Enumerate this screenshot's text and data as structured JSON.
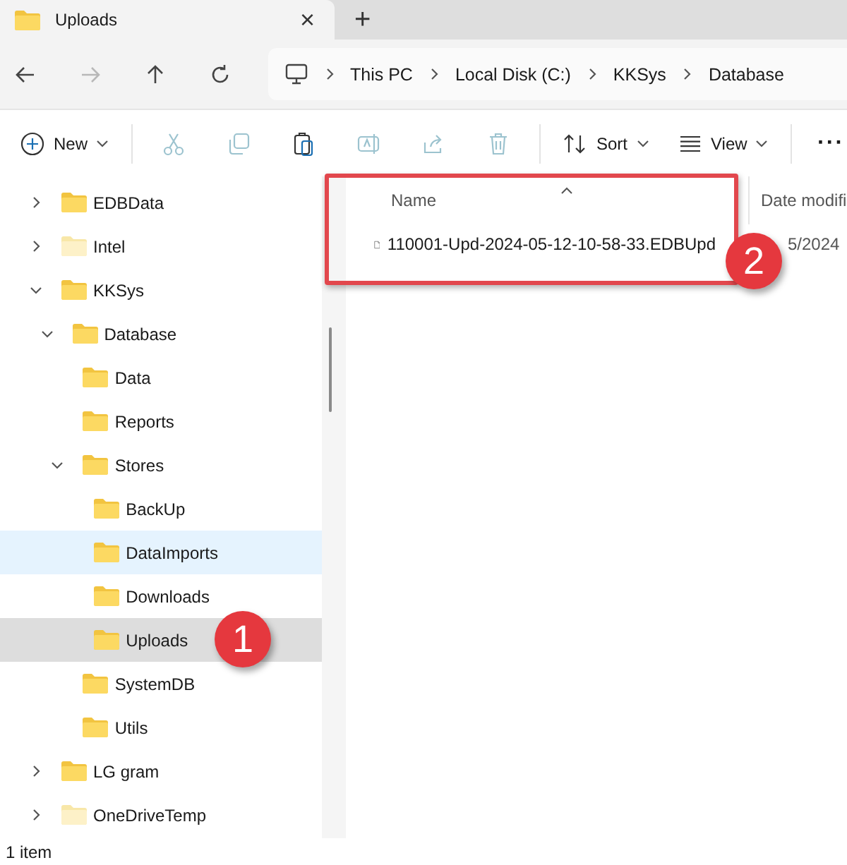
{
  "tab": {
    "title": "Uploads",
    "close": "×",
    "new_tab": "+"
  },
  "nav": {
    "back_disabled": false,
    "forward_disabled": true
  },
  "breadcrumbs": [
    "This PC",
    "Local Disk (C:)",
    "KKSys",
    "Database"
  ],
  "toolbar": {
    "new_label": "New",
    "sort_label": "Sort",
    "view_label": "View",
    "more": "···"
  },
  "tree": [
    {
      "label": "EDBData",
      "expanded": false,
      "hidden": false,
      "selected": false,
      "hovered": false
    },
    {
      "label": "Intel",
      "expanded": false,
      "hidden": true,
      "selected": false,
      "hovered": false
    },
    {
      "label": "KKSys",
      "expanded": true,
      "hidden": false,
      "selected": false,
      "hovered": false,
      "children": [
        {
          "label": "Database",
          "expanded": true,
          "hidden": false,
          "selected": false,
          "hovered": false,
          "children": [
            {
              "label": "Data",
              "hidden": false,
              "selected": false,
              "hovered": false
            },
            {
              "label": "Reports",
              "hidden": false,
              "selected": false,
              "hovered": false
            },
            {
              "label": "Stores",
              "expanded": true,
              "hidden": false,
              "selected": false,
              "hovered": false,
              "children": [
                {
                  "label": "BackUp",
                  "hidden": false,
                  "selected": false,
                  "hovered": false
                },
                {
                  "label": "DataImports",
                  "hidden": false,
                  "selected": false,
                  "hovered": true
                },
                {
                  "label": "Downloads",
                  "hidden": false,
                  "selected": false,
                  "hovered": false
                },
                {
                  "label": "Uploads",
                  "hidden": false,
                  "selected": true,
                  "hovered": false
                }
              ]
            },
            {
              "label": "SystemDB",
              "hidden": false,
              "selected": false,
              "hovered": false
            },
            {
              "label": "Utils",
              "hidden": false,
              "selected": false,
              "hovered": false
            }
          ]
        }
      ]
    },
    {
      "label": "LG gram",
      "expanded": false,
      "hidden": false,
      "selected": false,
      "hovered": false
    },
    {
      "label": "OneDriveTemp",
      "expanded": false,
      "hidden": true,
      "selected": false,
      "hovered": false
    }
  ],
  "columns": [
    {
      "label": "Name",
      "sorted": true
    },
    {
      "label": "Date modifi"
    }
  ],
  "files": [
    {
      "name": "110001-Upd-2024-05-12-10-58-33.EDBUpd",
      "date": "5/2024"
    }
  ],
  "annotations": [
    {
      "label": "1"
    },
    {
      "label": "2"
    }
  ],
  "status_bar": {
    "count": "1 item"
  }
}
